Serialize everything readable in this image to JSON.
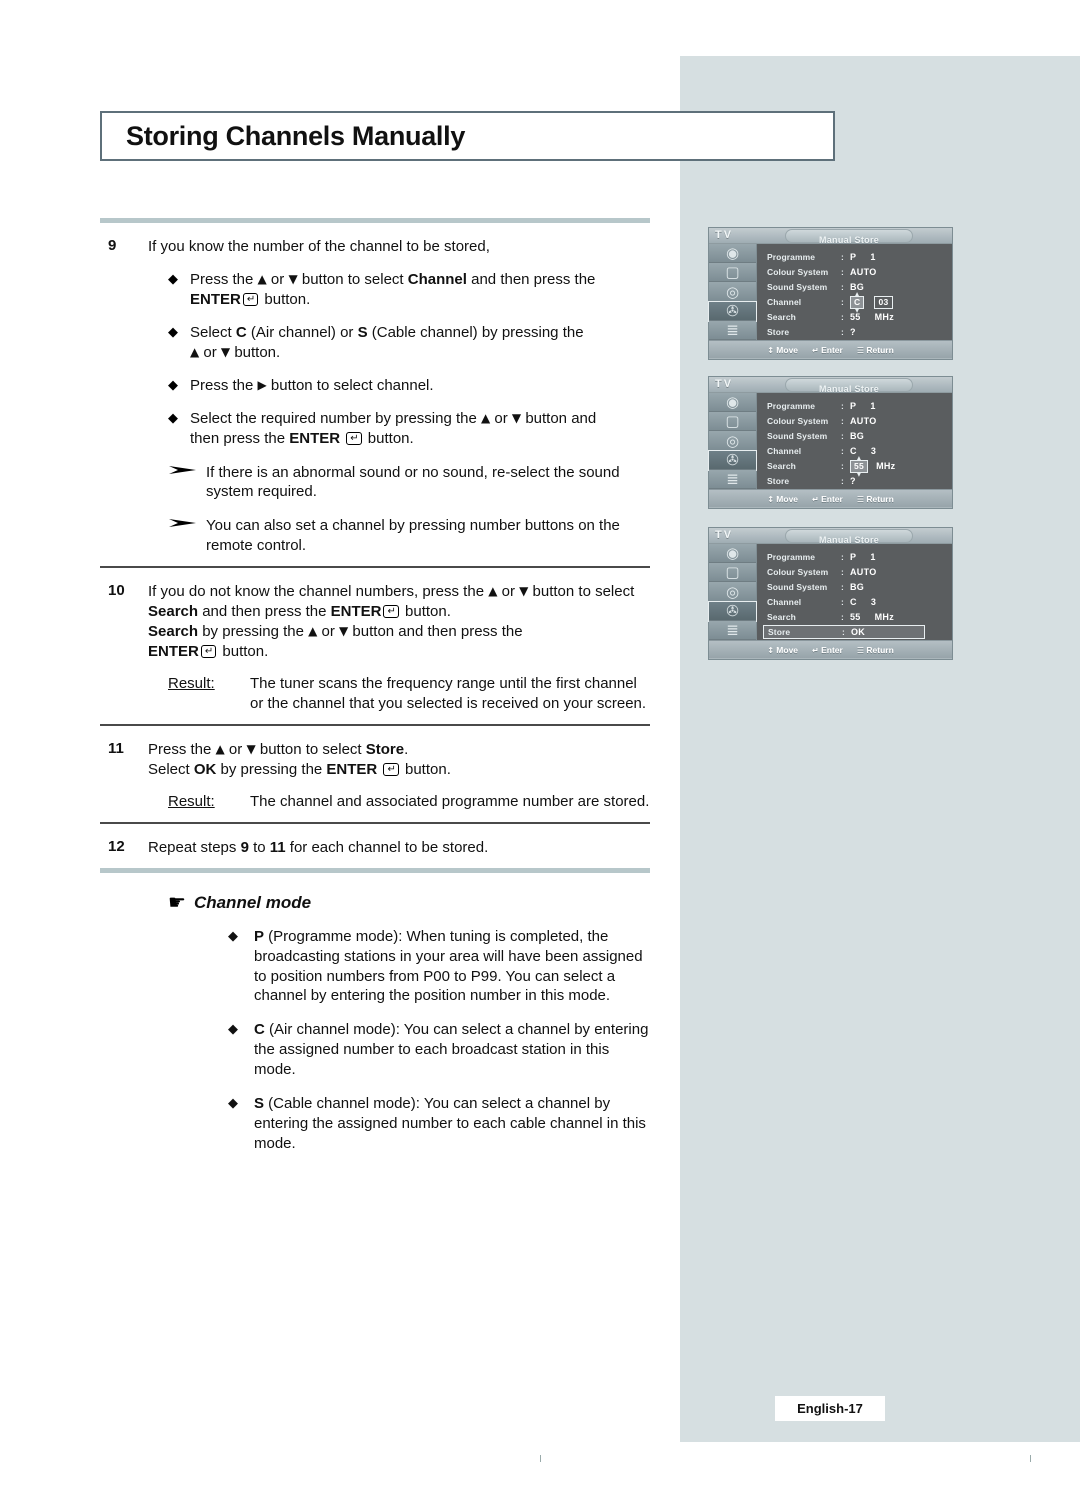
{
  "page": {
    "title": "Storing Channels Manually",
    "footer_label": "English-17"
  },
  "steps": [
    {
      "num": "9",
      "lead": "If you know the number of the channel to be stored,",
      "bullets": [
        "Press the ▲ or ▼ button to select Channel and then press the ENTER ↵ button.",
        "Select C (Air channel) or S (Cable channel) by pressing the ▲ or ▼ button.",
        "Press the ▶ button to select channel.",
        "Select the required number by pressing the ▲ or ▼ button and then press the ENTER ↵ button."
      ],
      "notes": [
        "If there is an abnormal sound or no sound, re-select the sound system required.",
        "You can also set a channel by pressing number buttons on the remote control."
      ]
    },
    {
      "num": "10",
      "lead": "If you do not know the channel numbers, press the ▲ or ▼ button to select Search and then press the ENTER ↵ button. Search by pressing the ▲ or ▼ button and then press the ENTER ↵ button.",
      "result_label": "Result:",
      "result_text": "The tuner scans the frequency range until the first channel or the channel that you selected is received on your screen."
    },
    {
      "num": "11",
      "lead": "Press the ▲ or ▼ button to select Store. Select OK by pressing the ENTER ↵ button.",
      "result_label": "Result:",
      "result_text": "The channel and associated programme number are stored."
    },
    {
      "num": "12",
      "lead": "Repeat steps 9 to 11 for each channel to be stored."
    }
  ],
  "channel_mode": {
    "heading": "Channel mode",
    "hand_icon": "pointing-hand-icon",
    "items": [
      "P (Programme mode): When tuning is completed, the broadcasting stations in your area will have been assigned to position numbers from P00 to P99. You can select a channel by entering the position number in this mode.",
      "C (Air channel mode): You can select a channel by entering the assigned number to each broadcast station in this mode.",
      "S (Cable channel mode): You can select a channel by entering the assigned number to each cable channel in this mode."
    ],
    "item_keys": [
      "P",
      "C",
      "S"
    ]
  },
  "osd_menus": [
    {
      "source_label": "TV",
      "tab_label": "Manual Store",
      "selected_icon_index": 3,
      "icons": [
        "picture-icon",
        "screen-icon",
        "sound-icon",
        "channel-icon",
        "setup-icon"
      ],
      "rows": [
        {
          "label": "Programme",
          "value": "P",
          "value2": "1",
          "highlight": false
        },
        {
          "label": "Colour System",
          "value": "AUTO",
          "value2": "",
          "highlight": false
        },
        {
          "label": "Sound System",
          "value": "BG",
          "value2": "",
          "highlight": false
        },
        {
          "label": "Channel",
          "value": "C",
          "value2": "03",
          "highlight": false,
          "widget": "spinner-plus-box"
        },
        {
          "label": "Search",
          "value": "55",
          "value2": "MHz",
          "highlight": false
        },
        {
          "label": "Store",
          "value": "?",
          "value2": "",
          "highlight": false
        }
      ],
      "footer": [
        {
          "icon": "↕",
          "label": "Move"
        },
        {
          "icon": "↵",
          "label": "Enter"
        },
        {
          "icon": "☰",
          "label": "Return"
        }
      ]
    },
    {
      "source_label": "TV",
      "tab_label": "Manual Store",
      "selected_icon_index": 3,
      "icons": [
        "picture-icon",
        "screen-icon",
        "sound-icon",
        "channel-icon",
        "setup-icon"
      ],
      "rows": [
        {
          "label": "Programme",
          "value": "P",
          "value2": "1",
          "highlight": false
        },
        {
          "label": "Colour System",
          "value": "AUTO",
          "value2": "",
          "highlight": false
        },
        {
          "label": "Sound System",
          "value": "BG",
          "value2": "",
          "highlight": false
        },
        {
          "label": "Channel",
          "value": "C",
          "value2": "3",
          "highlight": false
        },
        {
          "label": "Search",
          "value": "55",
          "value2": "MHz",
          "highlight": false,
          "widget": "spinner"
        },
        {
          "label": "Store",
          "value": "?",
          "value2": "",
          "highlight": false
        }
      ],
      "footer": [
        {
          "icon": "↕",
          "label": "Move"
        },
        {
          "icon": "↵",
          "label": "Enter"
        },
        {
          "icon": "☰",
          "label": "Return"
        }
      ]
    },
    {
      "source_label": "TV",
      "tab_label": "Manual Store",
      "selected_icon_index": 3,
      "icons": [
        "picture-icon",
        "screen-icon",
        "sound-icon",
        "channel-icon",
        "setup-icon"
      ],
      "rows": [
        {
          "label": "Programme",
          "value": "P",
          "value2": "1",
          "highlight": false
        },
        {
          "label": "Colour System",
          "value": "AUTO",
          "value2": "",
          "highlight": false
        },
        {
          "label": "Sound System",
          "value": "BG",
          "value2": "",
          "highlight": false
        },
        {
          "label": "Channel",
          "value": "C",
          "value2": "3",
          "highlight": false
        },
        {
          "label": "Search",
          "value": "55",
          "value2": "MHz",
          "highlight": false
        },
        {
          "label": "Store",
          "value": "OK",
          "value2": "",
          "highlight": true
        }
      ],
      "footer": [
        {
          "icon": "↕",
          "label": "Move"
        },
        {
          "icon": "↵",
          "label": "Enter"
        },
        {
          "icon": "☰",
          "label": "Return"
        }
      ]
    }
  ],
  "colors": {
    "sidebar_bg": "#d6dfe1",
    "rule_thick": "#b7c7ca",
    "rule_thin": "#4a4a4a",
    "title_border": "#5e707a",
    "osd_list_bg": "#5a5d5f"
  }
}
